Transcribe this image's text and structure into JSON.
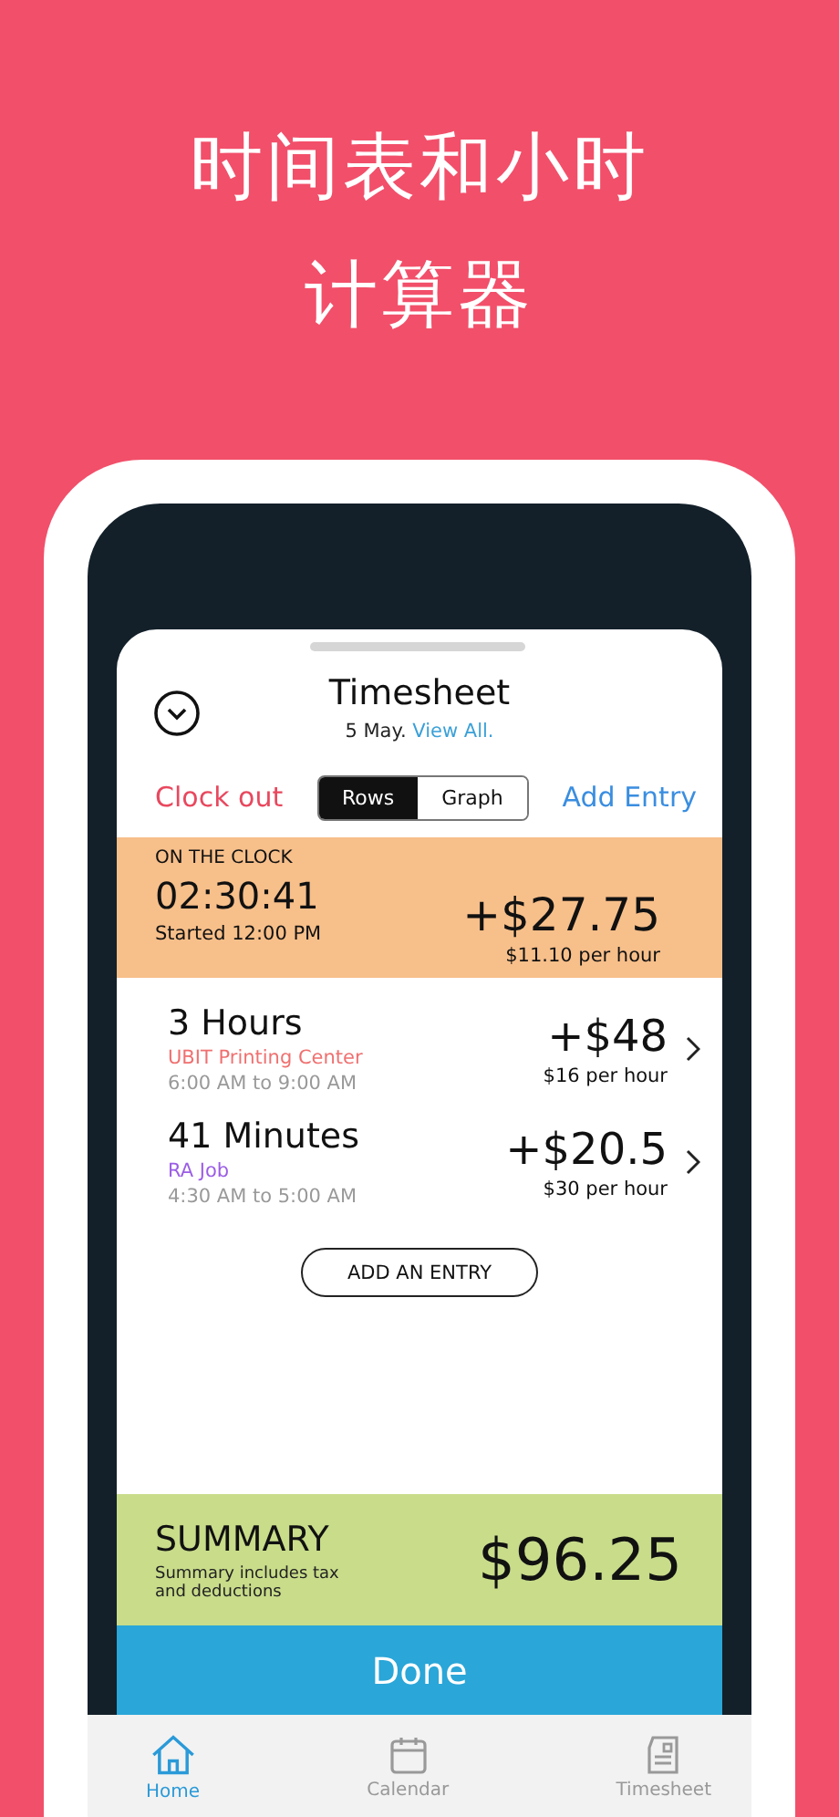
{
  "headline": [
    "时间表和小时",
    "计算器"
  ],
  "sheet": {
    "title": "Timesheet",
    "date": "5 May.",
    "view_all": "View All.",
    "clock_out": "Clock out",
    "add_entry": "Add Entry",
    "view_tabs": [
      {
        "label": "Rows",
        "selected": true
      },
      {
        "label": "Graph",
        "selected": false
      }
    ]
  },
  "on_the_clock": {
    "label": "ON THE CLOCK",
    "timer": "02:30:41",
    "started": "Started 12:00 PM",
    "amount": "+$27.75",
    "rate": "$11.10 per hour"
  },
  "entries": [
    {
      "duration": "3 Hours",
      "job": "UBIT Printing Center",
      "color": "#f07070",
      "time": "6:00 AM to 9:00 AM",
      "amount": "+$48",
      "rate": "$16 per hour"
    },
    {
      "duration": "41 Minutes",
      "job": "RA Job",
      "color": "#9b5de5",
      "time": "4:30 AM to 5:00 AM",
      "amount": "+$20.5",
      "rate": "$30 per hour"
    }
  ],
  "add_an_entry": "ADD AN ENTRY",
  "summary": {
    "title": "SUMMARY",
    "note": "Summary includes tax and deductions",
    "total": "$96.25"
  },
  "done": "Done",
  "tab_bar": [
    {
      "label": "Home",
      "kind": "home",
      "selected": true
    },
    {
      "label": "Calendar",
      "kind": "calendar",
      "selected": false
    },
    {
      "label": "Timesheet",
      "kind": "sheet",
      "selected": false
    }
  ]
}
